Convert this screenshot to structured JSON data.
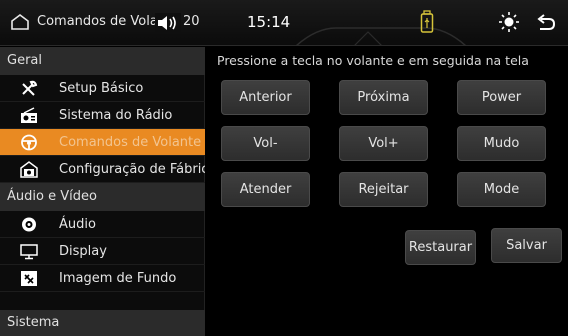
{
  "status_bar": {
    "title": "Comandos de Volante",
    "volume": "20",
    "clock": "15:14"
  },
  "sidebar": {
    "sections": [
      {
        "label": "Geral",
        "items": [
          {
            "label": "Setup Básico",
            "icon": "tools-icon"
          },
          {
            "label": "Sistema do Rádio",
            "icon": "radio-icon"
          },
          {
            "label": "Comandos de Volante",
            "icon": "steering-wheel-icon",
            "active": true
          },
          {
            "label": "Configuração de Fábrica",
            "icon": "factory-icon"
          }
        ]
      },
      {
        "label": "Áudio e Vídeo",
        "items": [
          {
            "label": "Áudio",
            "icon": "audio-icon"
          },
          {
            "label": "Display",
            "icon": "display-icon"
          },
          {
            "label": "Imagem de Fundo",
            "icon": "wallpaper-icon"
          }
        ]
      },
      {
        "label": "Sistema",
        "items": []
      }
    ]
  },
  "main": {
    "instruction": "Pressione a tecla no volante e em seguida na tela",
    "buttons": {
      "anterior": "Anterior",
      "proxima": "Próxima",
      "power": "Power",
      "vol_minus": "Vol-",
      "vol_plus": "Vol+",
      "mudo": "Mudo",
      "atender": "Atender",
      "rejeitar": "Rejeitar",
      "mode": "Mode",
      "restaurar": "Restaurar",
      "salvar": "Salvar"
    }
  },
  "colors": {
    "accent": "#e98a22",
    "active_text": "#f2c48f",
    "usb": "#d6c43a"
  }
}
